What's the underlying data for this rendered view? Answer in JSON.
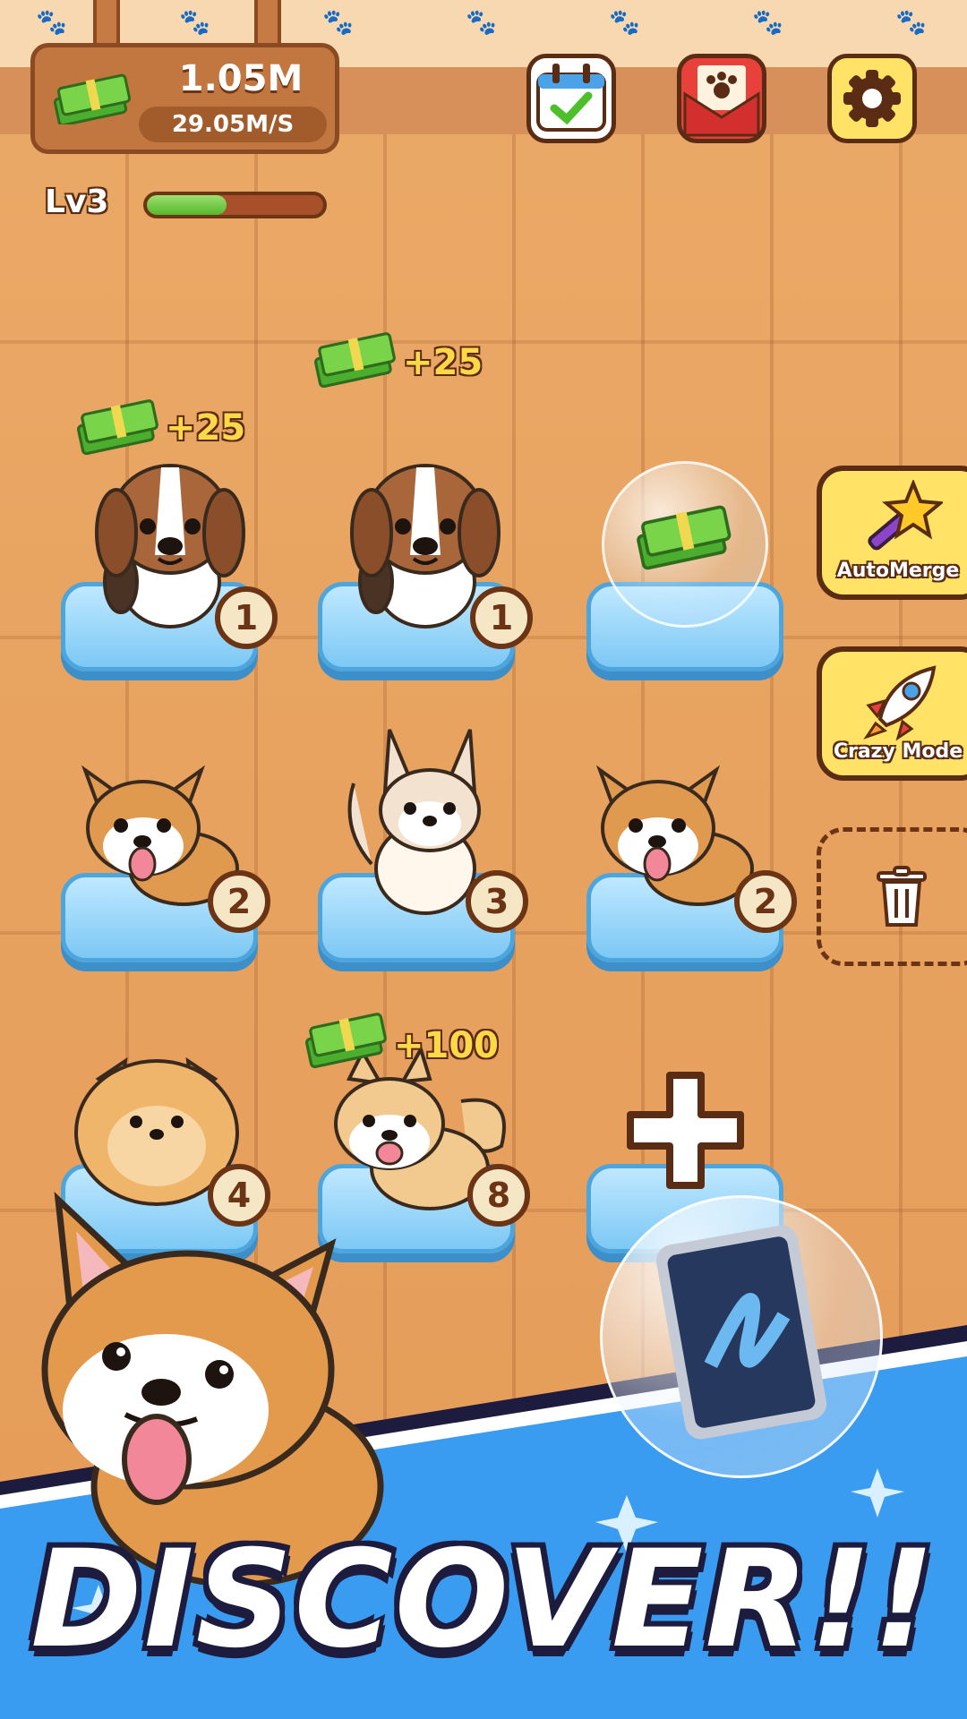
{
  "hud": {
    "money_value": "1.05M",
    "money_rate": "29.05M/S",
    "level_label": "Lv3",
    "level_progress": 0.45
  },
  "icons": {
    "calendar": "calendar-check-icon",
    "mail": "paw-mail-icon",
    "settings": "gear-icon",
    "cash": "cash-stack-icon",
    "wand": "magic-wand-icon",
    "rocket": "rocket-icon",
    "trash": "trash-icon",
    "plus": "plus-icon",
    "tablet": "tablet-icon"
  },
  "slots": [
    {
      "dog": "beagle",
      "level": "1",
      "reward": "+25"
    },
    {
      "dog": "beagle",
      "level": "1",
      "reward": "+25"
    },
    {
      "dog": "",
      "level": "",
      "reward": "",
      "bubble": "cash"
    },
    {
      "dog": "corgi",
      "level": "2",
      "reward": ""
    },
    {
      "dog": "chihuahua",
      "level": "3",
      "reward": ""
    },
    {
      "dog": "corgi",
      "level": "2",
      "reward": ""
    },
    {
      "dog": "pomeranian",
      "level": "4",
      "reward": ""
    },
    {
      "dog": "shiba",
      "level": "8",
      "reward": "+100"
    }
  ],
  "side_buttons": {
    "automerge_label": "AutoMerge",
    "crazy_mode_label": "Crazy Mode"
  },
  "banner": {
    "title": "DISCOVER!!"
  },
  "colors": {
    "floor": "#e8a25f",
    "cushion": "#7cc8f5",
    "button_yellow": "#ffe266",
    "banner_blue": "#3a9cf0",
    "level_green": "#56b82a"
  }
}
